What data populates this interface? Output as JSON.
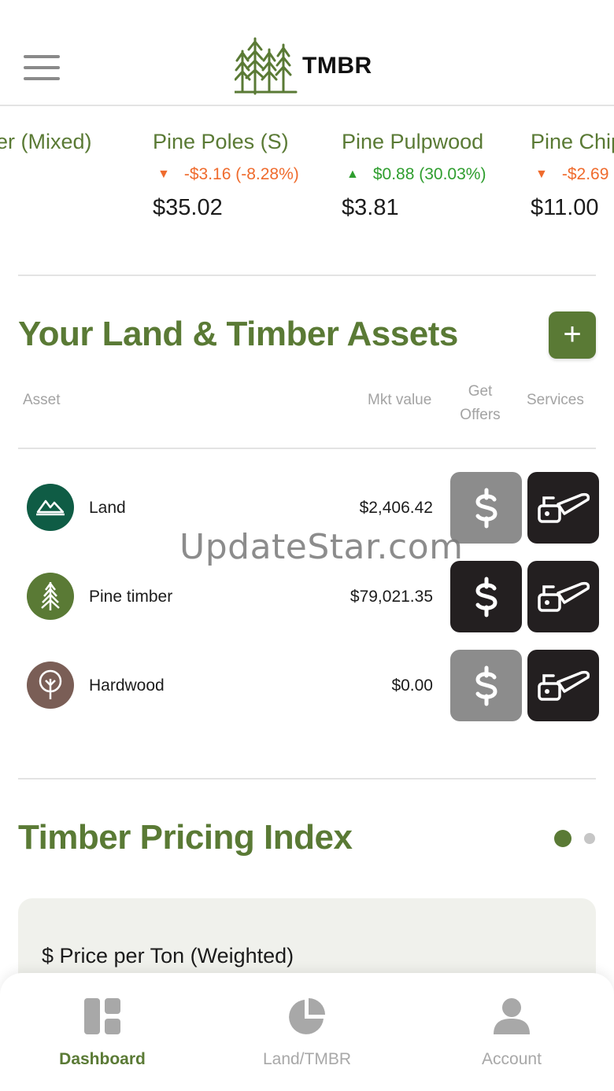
{
  "app": {
    "logo_text": "TMBR"
  },
  "ticker": [
    {
      "name": "ber (Mixed)",
      "change": "",
      "direction": "none",
      "price": ""
    },
    {
      "name": "Pine Poles (S)",
      "change": "-$3.16 (-8.28%)",
      "direction": "down",
      "price": "$35.02"
    },
    {
      "name": "Pine Pulpwood",
      "change": "$0.88 (30.03%)",
      "direction": "up",
      "price": "$3.81"
    },
    {
      "name": "Pine Chip",
      "change": "-$2.69",
      "direction": "down",
      "price": "$11.00"
    }
  ],
  "assets": {
    "title": "Your Land & Timber Assets",
    "add_label": "+",
    "columns": {
      "asset": "Asset",
      "mkt_value": "Mkt value",
      "get_offers_line1": "Get",
      "get_offers_line2": "Offers",
      "services": "Services"
    },
    "rows": [
      {
        "name": "Land",
        "value": "$2,406.42",
        "icon": "mountain-icon",
        "icon_color": "#0f5c45",
        "offers_enabled": false
      },
      {
        "name": "Pine timber",
        "value": "$79,021.35",
        "icon": "pine-tree-icon",
        "icon_color": "#5a7a35",
        "offers_enabled": true
      },
      {
        "name": "Hardwood",
        "value": "$0.00",
        "icon": "deciduous-tree-icon",
        "icon_color": "#7a5e56",
        "offers_enabled": false
      }
    ]
  },
  "watermark": "UpdateStar.com",
  "pricing": {
    "title": "Timber Pricing Index",
    "card_title": "$ Price per Ton (Weighted)",
    "page_count": 2,
    "active_page": 1
  },
  "nav": {
    "items": [
      {
        "label": "Dashboard",
        "icon": "dashboard-icon",
        "active": true
      },
      {
        "label": "Land/TMBR",
        "icon": "pie-chart-icon",
        "active": false
      },
      {
        "label": "Account",
        "icon": "user-icon",
        "active": false
      }
    ]
  },
  "colors": {
    "brand_green": "#5a7a35",
    "change_down": "#ef6b2d",
    "change_up": "#2f9e2f",
    "button_dark": "#231f20",
    "button_disabled": "#8c8c8c"
  }
}
